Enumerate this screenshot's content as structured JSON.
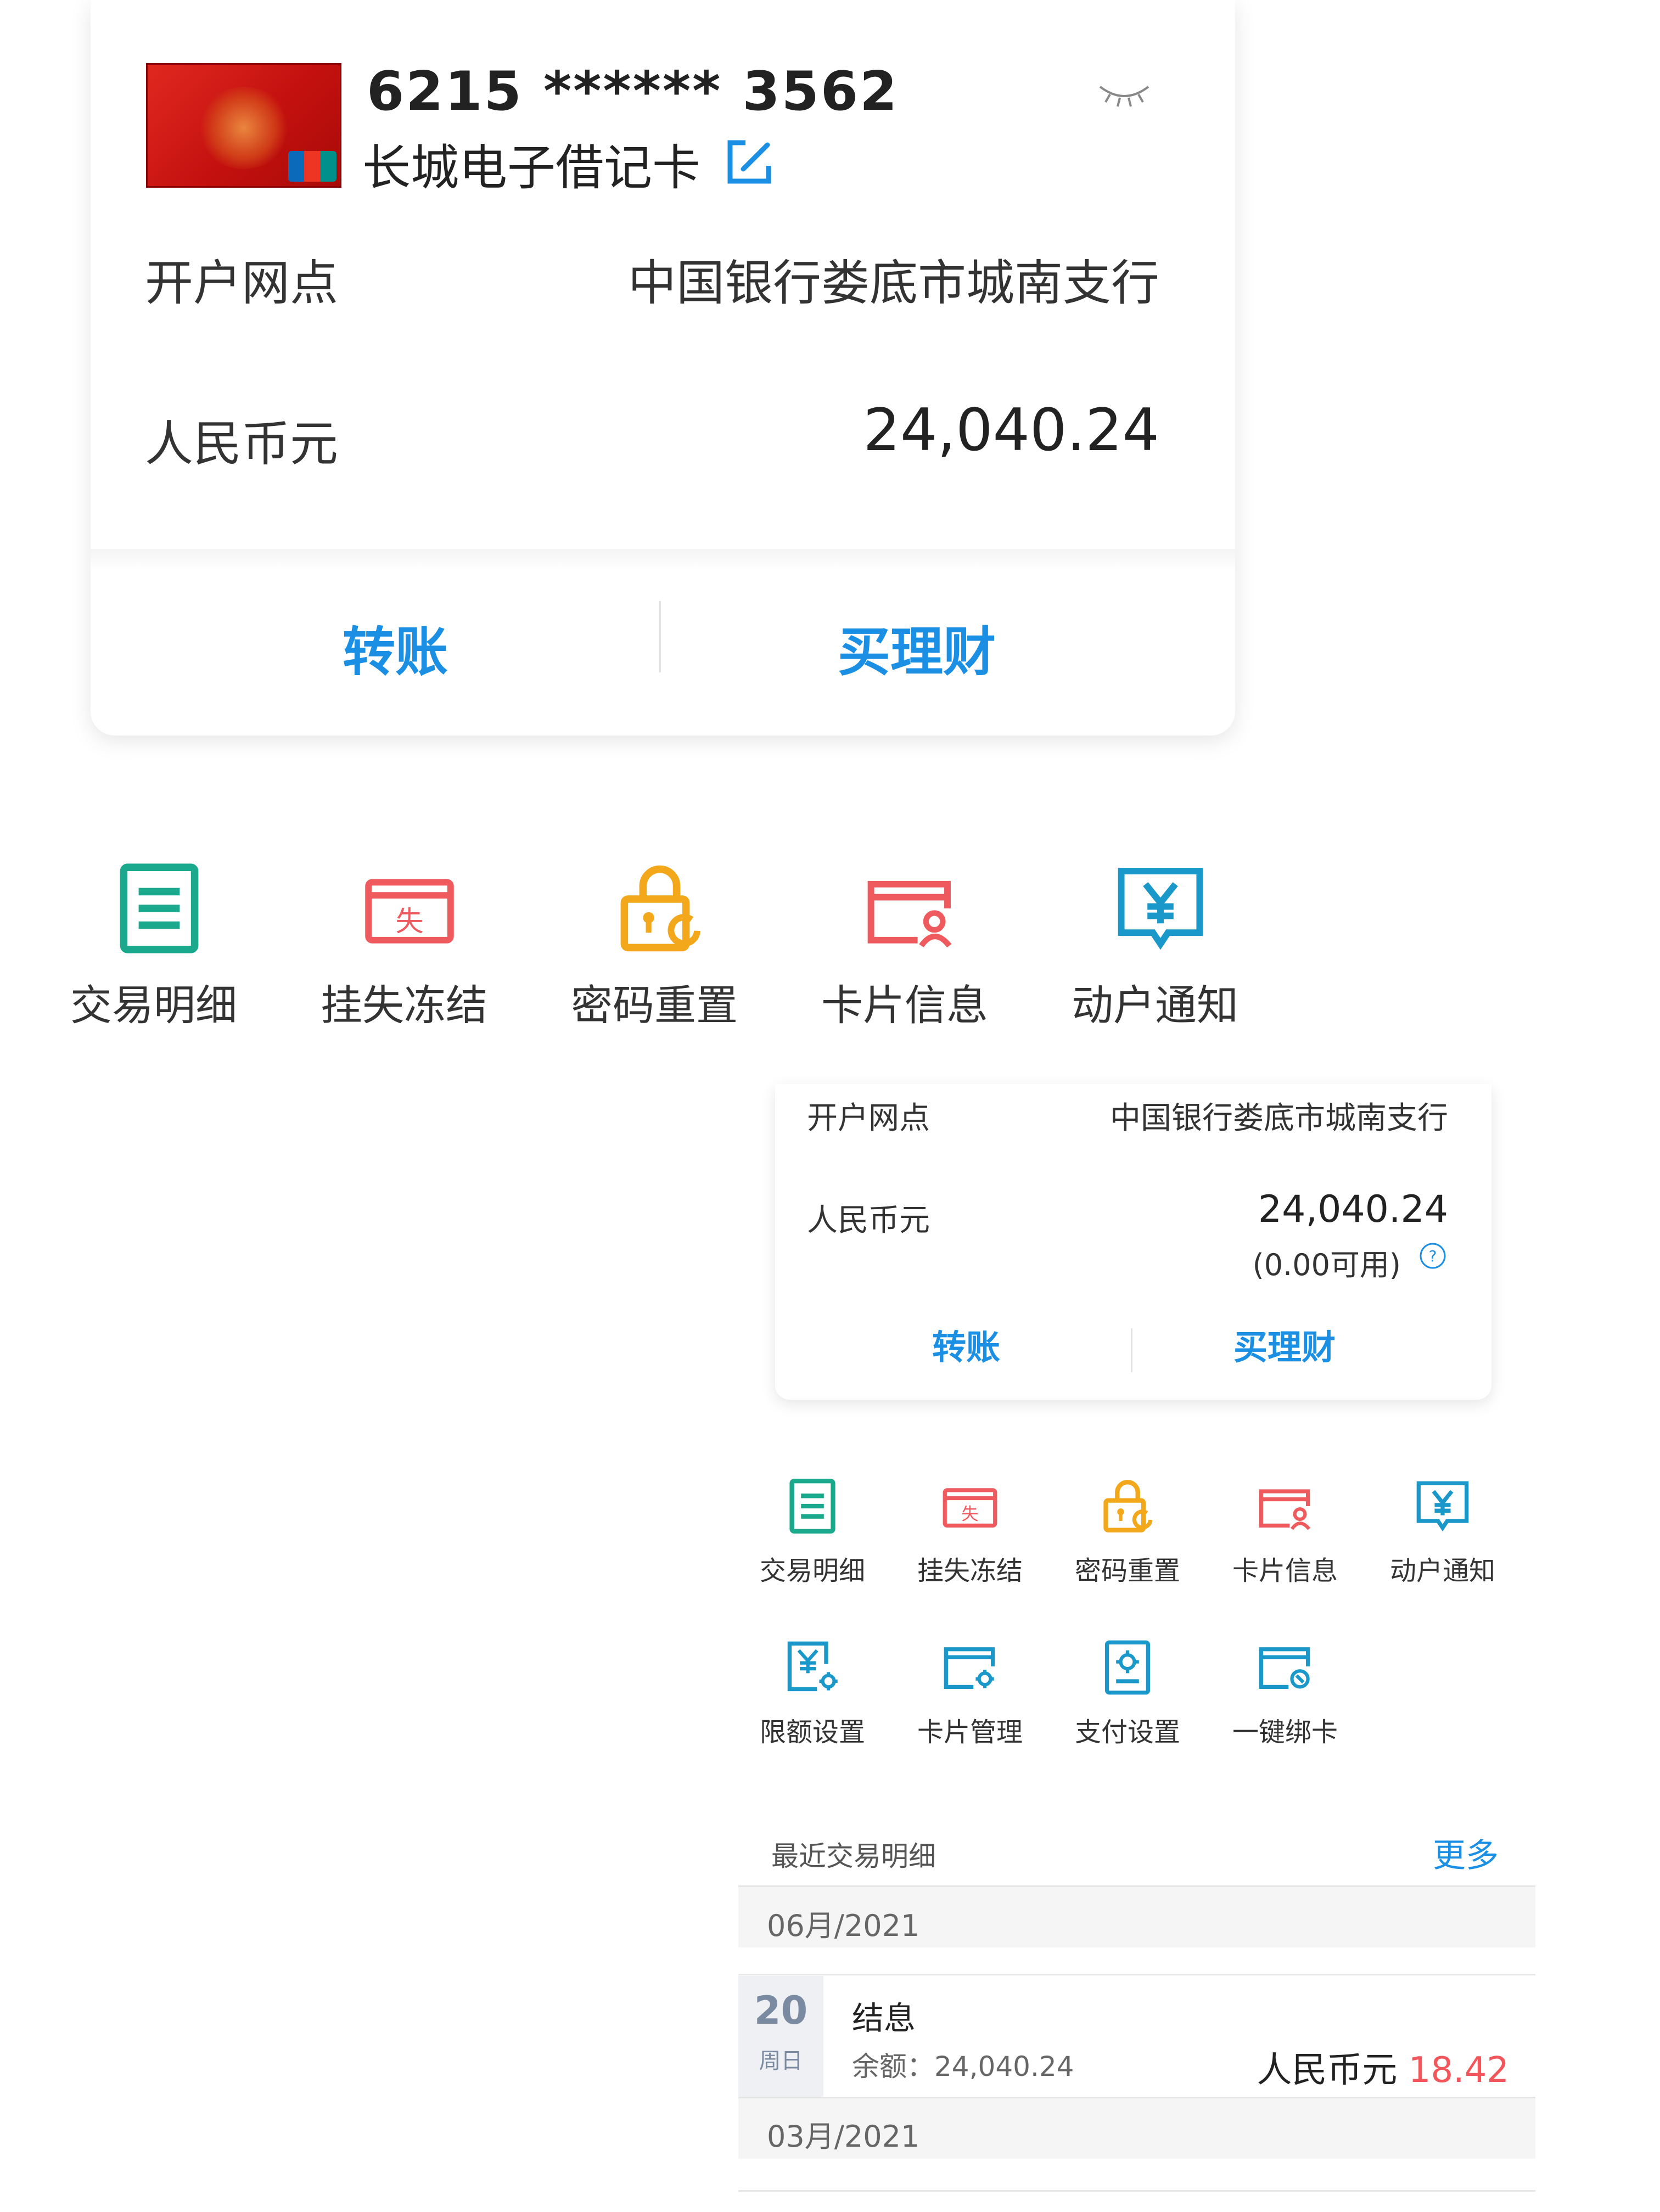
{
  "big_card": {
    "card_number": "6215 ****** 3562",
    "card_name": "长城电子借记卡",
    "branch_label": "开户网点",
    "branch_value": "中国银行娄底市城南支行",
    "currency_label": "人民币元",
    "balance": "24,040.24",
    "transfer_button": "转账",
    "wealth_button": "买理财"
  },
  "big_actions": [
    {
      "label": "交易明细",
      "icon": "transaction-list-icon"
    },
    {
      "label": "挂失冻结",
      "icon": "loss-report-icon"
    },
    {
      "label": "密码重置",
      "icon": "lock-reset-icon"
    },
    {
      "label": "卡片信息",
      "icon": "card-info-icon"
    },
    {
      "label": "动户通知",
      "icon": "yuan-notice-icon"
    }
  ],
  "small_card": {
    "branch_label": "开户网点",
    "branch_value": "中国银行娄底市城南支行",
    "currency_label": "人民币元",
    "balance": "24,040.24",
    "available": "(0.00可用)",
    "transfer_button": "转账",
    "wealth_button": "买理财"
  },
  "small_actions": [
    {
      "label": "交易明细",
      "icon": "transaction-list-icon"
    },
    {
      "label": "挂失冻结",
      "icon": "loss-report-icon"
    },
    {
      "label": "密码重置",
      "icon": "lock-reset-icon"
    },
    {
      "label": "卡片信息",
      "icon": "card-info-icon"
    },
    {
      "label": "动户通知",
      "icon": "yuan-notice-icon"
    },
    {
      "label": "限额设置",
      "icon": "limit-settings-icon"
    },
    {
      "label": "卡片管理",
      "icon": "card-manage-icon"
    },
    {
      "label": "支付设置",
      "icon": "payment-settings-icon"
    },
    {
      "label": "一键绑卡",
      "icon": "bind-card-icon"
    }
  ],
  "recent": {
    "title": "最近交易明细",
    "more": "更多",
    "months": [
      "06月/2021",
      "03月/2021"
    ],
    "transactions": [
      {
        "day": "20",
        "weekday": "周日",
        "name": "结息",
        "balance_text": "余额：24,040.24",
        "currency": "人民币元",
        "amount": "18.42"
      }
    ]
  },
  "colors": {
    "accent_blue": "#1a8fe3",
    "green": "#1aa98c",
    "red": "#ef5a5f",
    "orange": "#f3a71a",
    "amount_red": "#f2555a"
  }
}
